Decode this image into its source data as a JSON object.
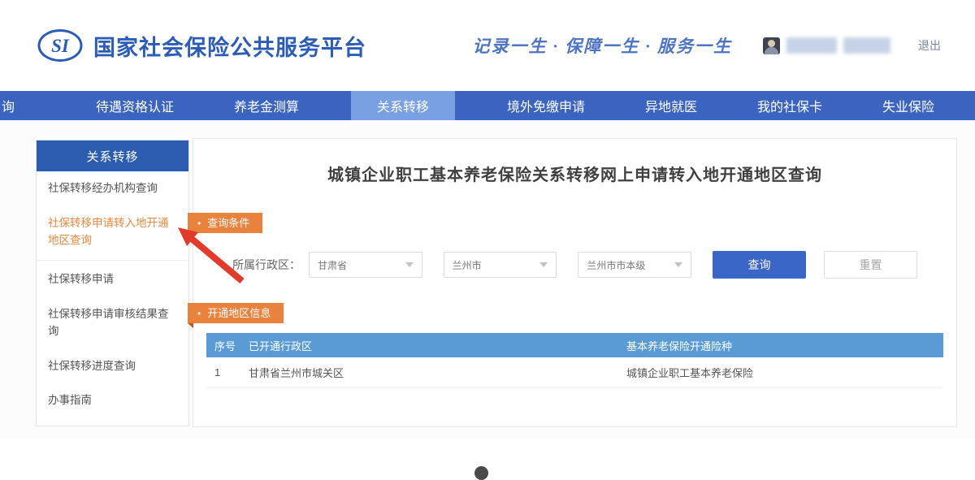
{
  "header": {
    "logo_text": "SI",
    "title": "国家社会保险公共服务平台",
    "slogan": "记录一生 · 保障一生 · 服务一生",
    "logout_label": "退出"
  },
  "nav": {
    "cut_item": "询",
    "items": [
      {
        "label": "待遇资格认证"
      },
      {
        "label": "养老金测算"
      },
      {
        "label": "关系转移"
      },
      {
        "label": "境外免缴申请"
      },
      {
        "label": "异地就医"
      },
      {
        "label": "我的社保卡"
      },
      {
        "label": "失业保险"
      }
    ],
    "active_item": "关系转移"
  },
  "sidebar": {
    "title": "关系转移",
    "items": [
      {
        "label": "社保转移经办机构查询"
      },
      {
        "label": "社保转移申请转入地开通地区查询"
      },
      {
        "label": "社保转移申请"
      },
      {
        "label": "社保转移申请审核结果查询"
      },
      {
        "label": "社保转移进度查询"
      },
      {
        "label": "办事指南"
      }
    ],
    "active_item": "社保转移申请转入地开通地区查询"
  },
  "main": {
    "page_title": "城镇企业职工基本养老保险关系转移网上申请转入地开通地区查询",
    "query_section": {
      "bullet": "•",
      "label": "查询条件"
    },
    "form": {
      "region_label": "所属行政区：",
      "province_value": "甘肃省",
      "city_value": "兰州市",
      "district_value": "兰州市市本级"
    },
    "buttons": {
      "query": "查询",
      "reset": "重置"
    },
    "result_section": {
      "bullet": "•",
      "label": "开通地区信息"
    },
    "table": {
      "headers": [
        "序号",
        "已开通行政区",
        "基本养老保险开通险种"
      ],
      "rows": [
        [
          "1",
          "甘肃省兰州市城关区",
          "城镇企业职工基本养老保险"
        ]
      ]
    }
  },
  "colors": {
    "brand_blue": "#2b5cb8",
    "nav_blue": "#3b64c0",
    "nav_active_blue": "#7aa0e4",
    "sidebar_header_blue": "#2b5cb0",
    "section_tag_orange": "#e8823d",
    "active_link_orange": "#e8883f",
    "table_header_blue": "#5b9bd5",
    "primary_button_blue": "#3a66c8",
    "annotation_arrow_red": "#e23b2c"
  },
  "icons": {
    "logo": "si-oval-logo",
    "avatar": "user-avatar",
    "select_chevron": "chevron-down-icon",
    "annotation": "red-arrow"
  }
}
